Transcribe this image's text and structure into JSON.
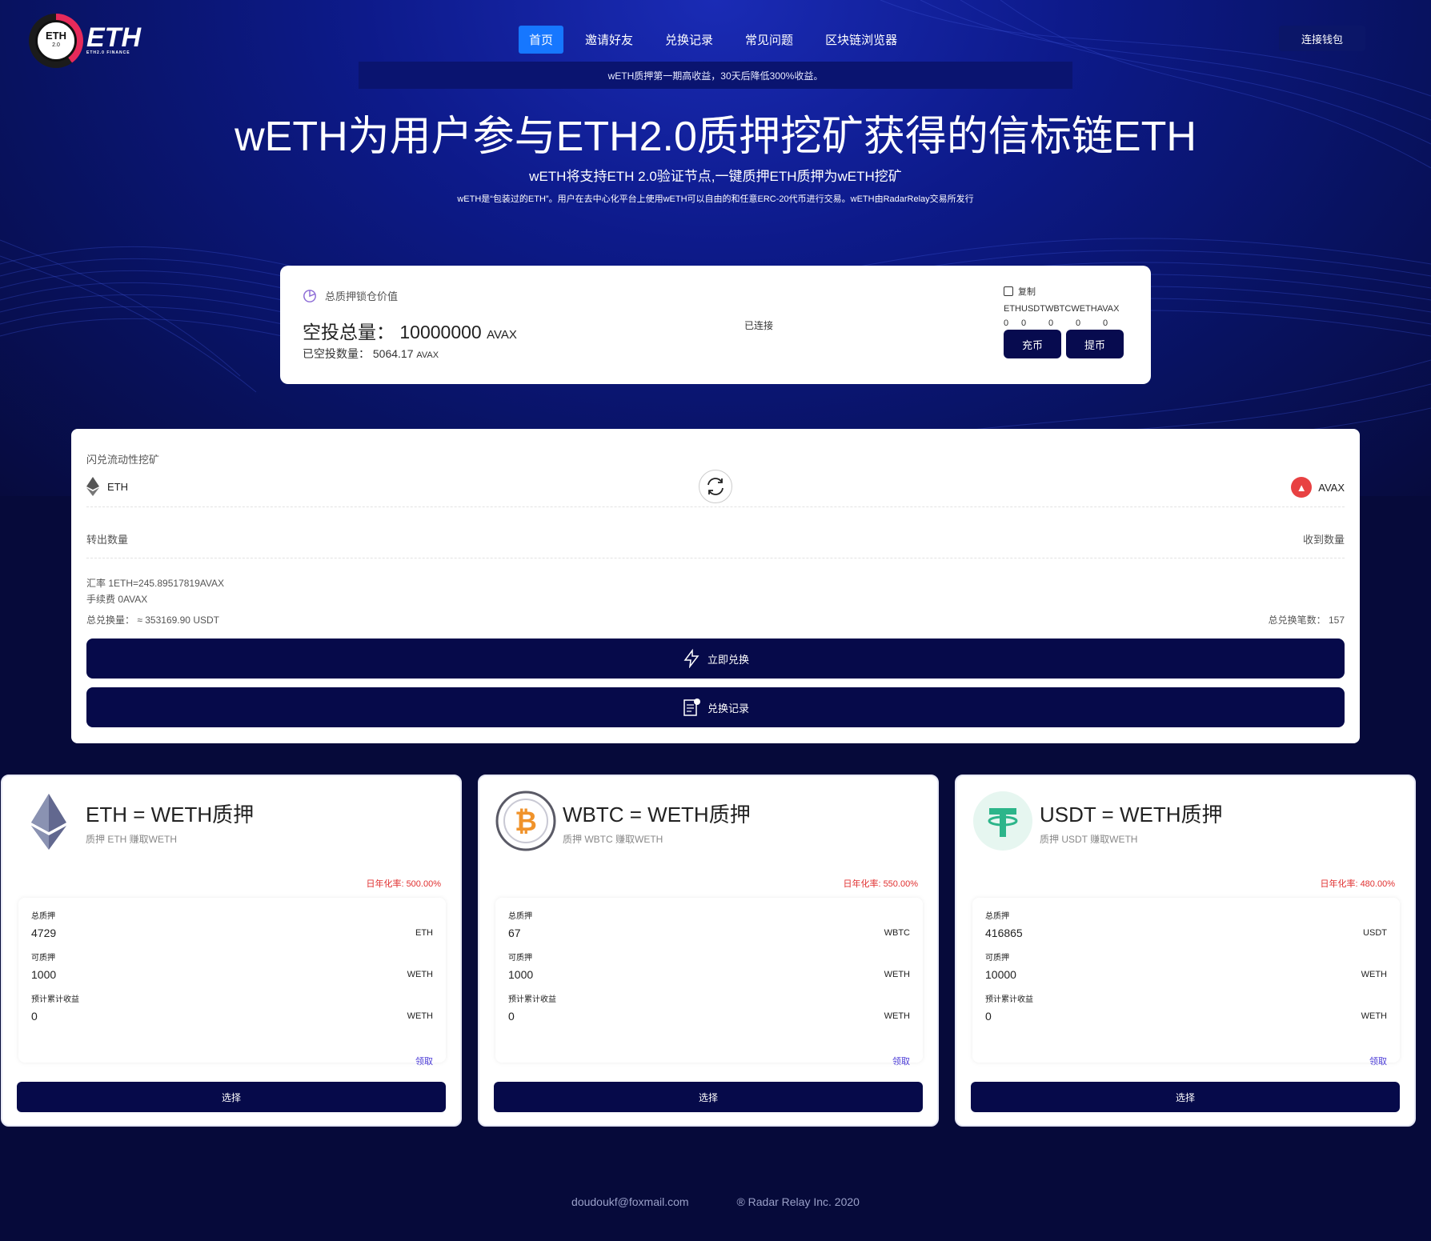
{
  "brand": {
    "logo_text": "ETH",
    "logo_badge": "ETH",
    "logo_badge_sub": "2.0",
    "logo_tagline": "ETH2.0 FINANCE"
  },
  "nav": {
    "items": [
      "首页",
      "邀请好友",
      "兑换记录",
      "常见问题",
      "区块链浏览器"
    ],
    "active_index": 0,
    "connect_label": "连接钱包"
  },
  "notice": "wETH质押第一期高收益，30天后降低300%收益。",
  "hero": {
    "title": "wETH为用户参与ETH2.0质押挖矿获得的信标链ETH",
    "subtitle": "wETH将支持ETH 2.0验证节点,一键质押ETH质押为wETH挖矿",
    "desc": "wETH是“包装过的ETH”。用户在去中心化平台上使用wETH可以自由的和任意ERC-20代币进行交易。wETH由RadarRelay交易所发行"
  },
  "tvl": {
    "label": "总质押锁仓价值",
    "total_label": "空投总量：",
    "total_value": "10000000",
    "total_unit": "AVAX",
    "distributed_label": "已空投数量：",
    "distributed_value": "5064.17",
    "distributed_unit": "AVAX",
    "status": "已连接",
    "copy_label": "复制",
    "tokens": "ETHUSDTWBTCWETHAVAX",
    "balances": [
      "0",
      "0",
      "0",
      "0",
      "0"
    ],
    "deposit_label": "充币",
    "withdraw_label": "提币"
  },
  "swap": {
    "title": "闪兑流动性挖矿",
    "from_token": "ETH",
    "to_token": "AVAX",
    "out_label": "转出数量",
    "in_label": "收到数量",
    "rate": "汇率  1ETH=245.89517819AVAX",
    "fee": "手续费  0AVAX",
    "total_volume": "总兑换量：  ≈ 353169.90 USDT",
    "total_count": "总兑换笔数：  157",
    "swap_button": "立即兑换",
    "records_button": "兑换记录"
  },
  "pools": [
    {
      "icon": "ethereum-icon",
      "title": "ETH = WETH质押",
      "subtitle": "质押 ETH 赚取WETH",
      "apr": "日年化率: 500.00%",
      "total_label": "总质押",
      "total_value": "4729",
      "total_unit": "ETH",
      "available_label": "可质押",
      "available_value": "1000",
      "available_unit": "WETH",
      "earn_label": "预计累计收益",
      "earn_value": "0",
      "earn_unit": "WETH",
      "claim_label": "领取",
      "select_label": "选择"
    },
    {
      "icon": "bitcoin-icon",
      "title": "WBTC = WETH质押",
      "subtitle": "质押 WBTC 赚取WETH",
      "apr": "日年化率: 550.00%",
      "total_label": "总质押",
      "total_value": "67",
      "total_unit": "WBTC",
      "available_label": "可质押",
      "available_value": "1000",
      "available_unit": "WETH",
      "earn_label": "预计累计收益",
      "earn_value": "0",
      "earn_unit": "WETH",
      "claim_label": "领取",
      "select_label": "选择"
    },
    {
      "icon": "tether-icon",
      "title": "USDT = WETH质押",
      "subtitle": "质押 USDT 赚取WETH",
      "apr": "日年化率: 480.00%",
      "total_label": "总质押",
      "total_value": "416865",
      "total_unit": "USDT",
      "available_label": "可质押",
      "available_value": "10000",
      "available_unit": "WETH",
      "earn_label": "预计累计收益",
      "earn_value": "0",
      "earn_unit": "WETH",
      "claim_label": "领取",
      "select_label": "选择"
    }
  ],
  "footer": {
    "email": "doudoukf@foxmail.com",
    "copyright": "® Radar Relay Inc. 2020"
  },
  "colors": {
    "accent": "#1677ff",
    "button_dark": "#060a4a",
    "apr_red": "#e03030",
    "claim_purple": "#4b3bd6"
  }
}
